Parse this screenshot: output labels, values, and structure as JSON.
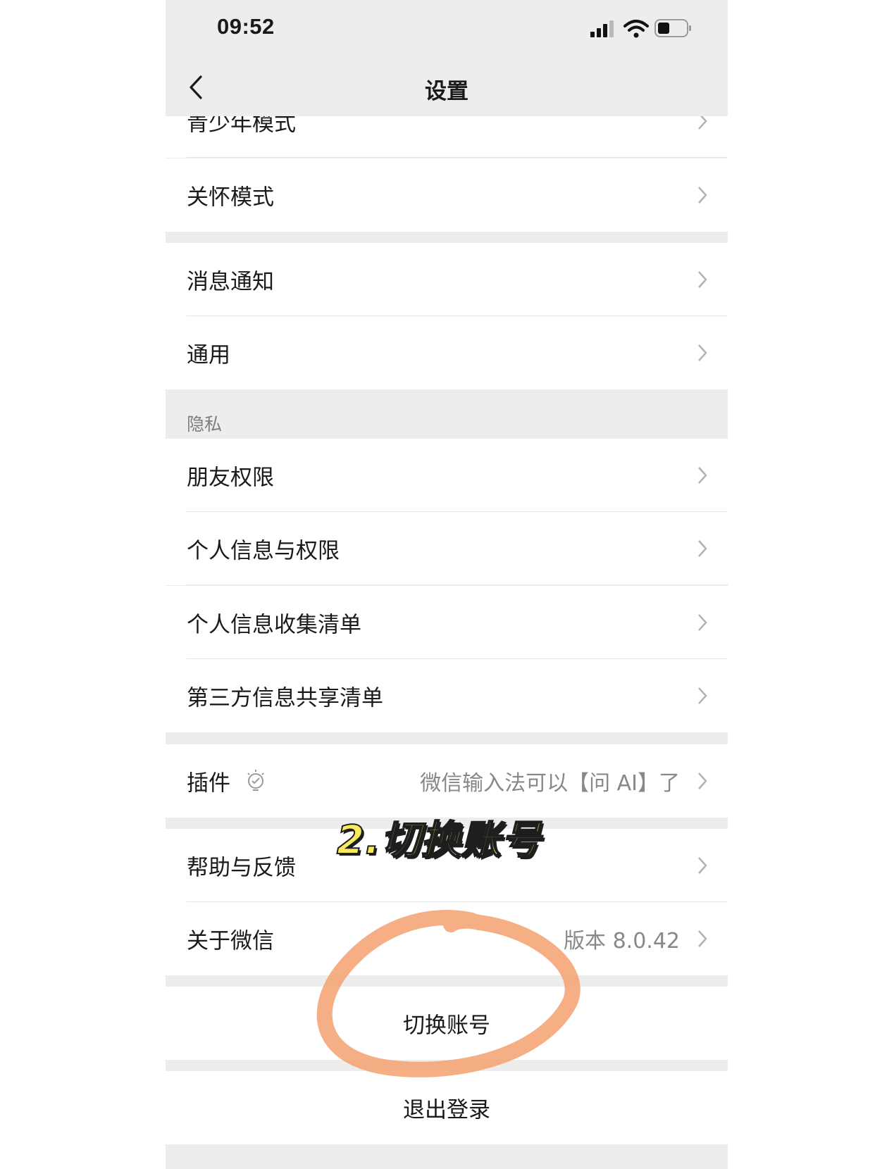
{
  "status_bar": {
    "time": "09:52"
  },
  "nav": {
    "title": "设置"
  },
  "rows": {
    "teen_mode": "青少年模式",
    "care_mode": "关怀模式",
    "notifications": "消息通知",
    "general": "通用",
    "friend_permissions": "朋友权限",
    "personal_info_permissions": "个人信息与权限",
    "personal_info_list": "个人信息收集清单",
    "third_party_list": "第三方信息共享清单",
    "plugins": {
      "label": "插件",
      "hint": "微信输入法可以【问 AI】了"
    },
    "help_feedback": "帮助与反馈",
    "about": {
      "label": "关于微信",
      "value": "版本 8.0.42"
    }
  },
  "sections": {
    "privacy": "隐私"
  },
  "actions": {
    "switch_account": "切换账号",
    "logout": "退出登录"
  },
  "annotation": {
    "caption": "2.切换账号",
    "circle_color": "#f5a06f"
  }
}
